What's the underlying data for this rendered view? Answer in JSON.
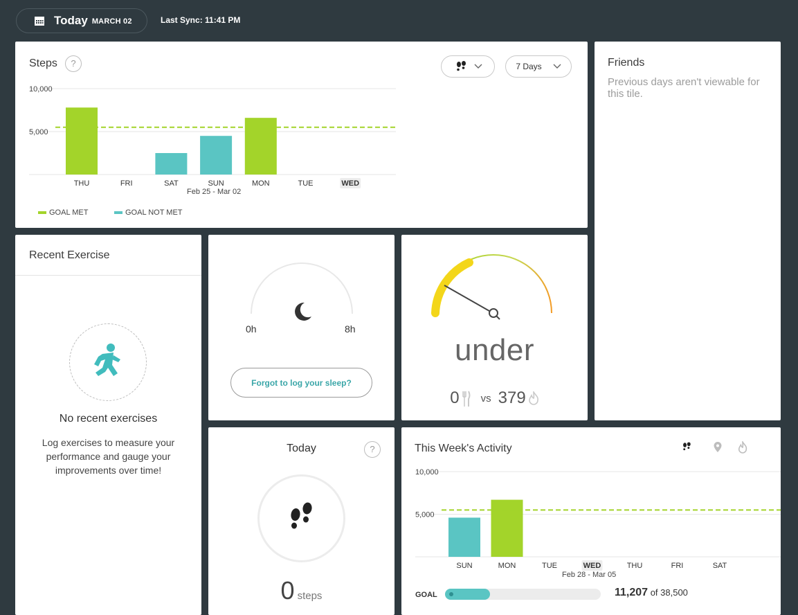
{
  "header": {
    "today_label": "Today",
    "date_label": "MARCH 02",
    "sync_label": "Last Sync: 11:41 PM",
    "icon": "calendar-icon"
  },
  "colors": {
    "goal_met": "#a3d42a",
    "goal_not_met": "#5ac5c3",
    "goal_line": "#a3d42a",
    "background": "#2f3a40"
  },
  "steps_tile": {
    "title": "Steps",
    "help": "?",
    "metric_icon": "footsteps-icon",
    "range_label": "7 Days",
    "legend_met": "GOAL MET",
    "legend_not_met": "GOAL NOT MET",
    "date_range": "Feb 25 - Mar 02"
  },
  "friends_tile": {
    "title": "Friends",
    "message": "Previous days aren't viewable for this tile."
  },
  "exercise_tile": {
    "title": "Recent Exercise",
    "empty_title": "No recent exercises",
    "empty_body": "Log exercises to measure your performance and gauge your improvements over time!"
  },
  "sleep_tile": {
    "min_label": "0h",
    "max_label": "8h",
    "log_button": "Forgot to log your sleep?"
  },
  "calorie_tile": {
    "status": "under",
    "eaten": "0",
    "vs": "vs",
    "burned": "379"
  },
  "today_steps_tile": {
    "title": "Today",
    "help": "?",
    "value": "0",
    "unit": "steps"
  },
  "week_tile": {
    "title": "This Week's Activity",
    "date_range": "Feb 28 - Mar 05",
    "goal_label": "GOAL",
    "total": "11,207",
    "of_label": "of 38,500",
    "goal_progress": 0.291
  },
  "chart_data": [
    {
      "type": "bar",
      "title": "Steps",
      "categories": [
        "THU",
        "FRI",
        "SAT",
        "SUN",
        "MON",
        "TUE",
        "WED"
      ],
      "values": [
        7800,
        0,
        2500,
        4500,
        6600,
        0,
        0
      ],
      "goal": 5500,
      "highlight": "WED",
      "y_ticks": [
        {
          "value": 10000,
          "label": "10,000"
        },
        {
          "value": 5000,
          "label": "5,000"
        }
      ],
      "ylim": [
        0,
        10000
      ],
      "grid": true,
      "legend": "bottom-left"
    },
    {
      "type": "bar",
      "title": "This Week's Activity",
      "categories": [
        "SUN",
        "MON",
        "TUE",
        "WED",
        "THU",
        "FRI",
        "SAT"
      ],
      "values": [
        4600,
        6700,
        0,
        0,
        0,
        0,
        0
      ],
      "goal": 5500,
      "highlight": "WED",
      "y_ticks": [
        {
          "value": 10000,
          "label": "10,000"
        },
        {
          "value": 5000,
          "label": "5,000"
        }
      ],
      "ylim": [
        0,
        10000
      ],
      "grid": true
    }
  ]
}
